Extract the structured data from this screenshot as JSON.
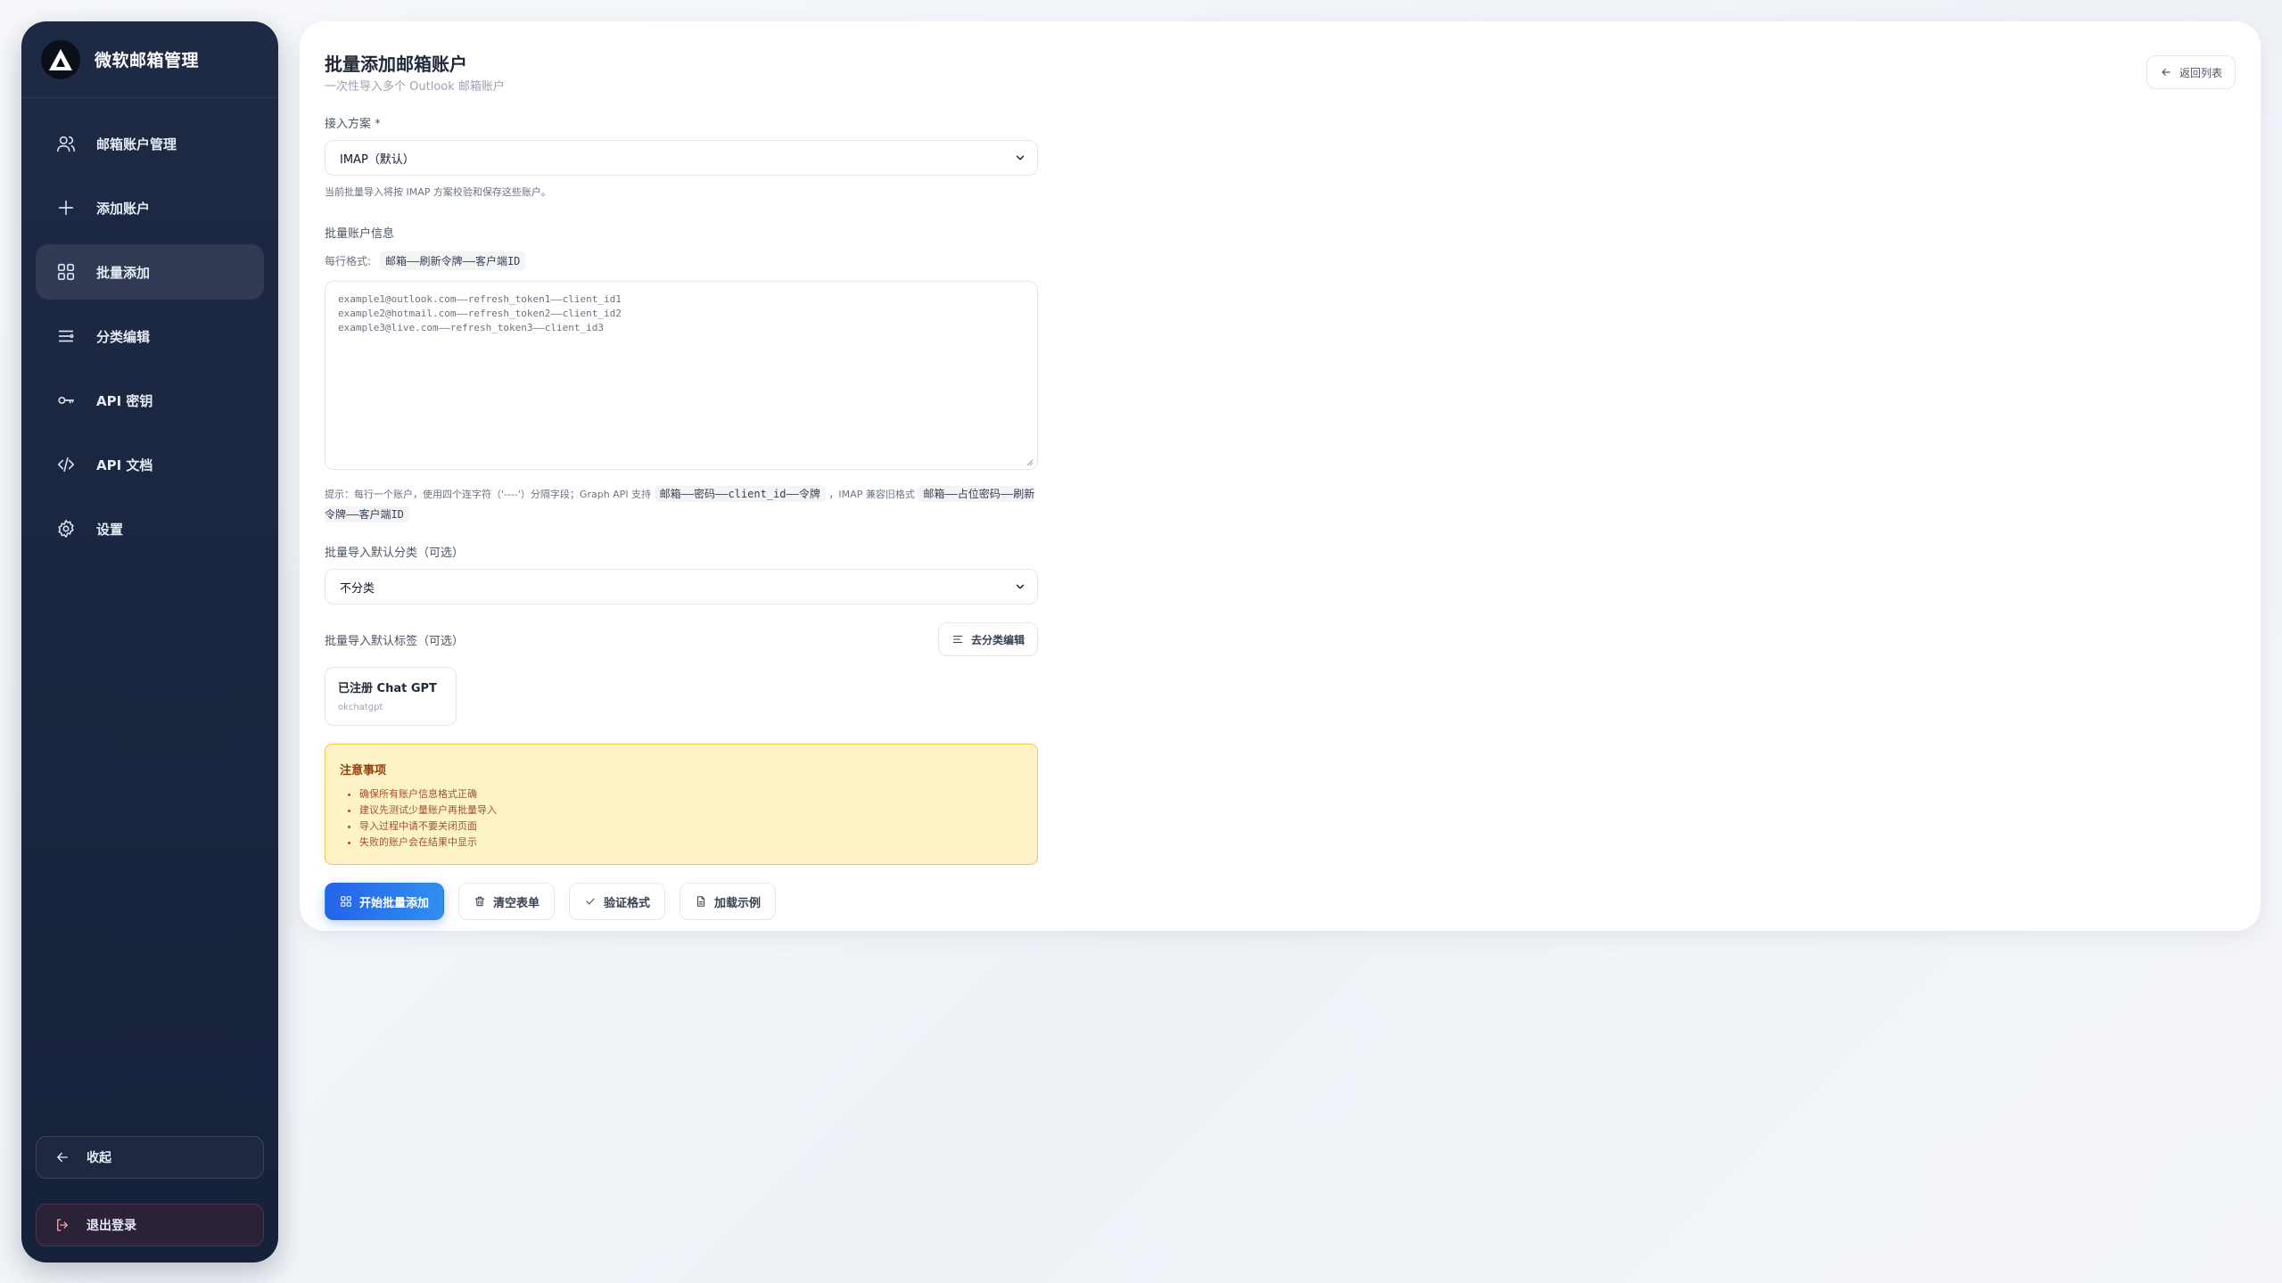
{
  "brand": {
    "title": "微软邮箱管理",
    "logo_icon": "triangle-logo-icon"
  },
  "sidebar": {
    "items": [
      {
        "label": "邮箱账户管理",
        "icon": "users-icon"
      },
      {
        "label": "添加账户",
        "icon": "plus-icon"
      },
      {
        "label": "批量添加",
        "icon": "grid-icon",
        "active": true
      },
      {
        "label": "分类编辑",
        "icon": "list-filter-icon"
      },
      {
        "label": "API 密钥",
        "icon": "key-icon"
      },
      {
        "label": "API 文档",
        "icon": "code-icon"
      },
      {
        "label": "设置",
        "icon": "gear-icon"
      }
    ],
    "collapse_label": "收起",
    "logout_label": "退出登录"
  },
  "header": {
    "title": "批量添加邮箱账户",
    "subtitle": "一次性导入多个 Outlook 邮箱账户",
    "back_label": "返回列表"
  },
  "form": {
    "scheme_label": "接入方案 *",
    "scheme_value": "IMAP（默认）",
    "scheme_help": "当前批量导入将按 IMAP 方案校验和保存这些账户。",
    "accounts_label": "批量账户信息",
    "format_prefix": "每行格式:",
    "format_code": "邮箱——刷新令牌——客户端ID",
    "textarea_lines": [
      "example1@outlook.com——refresh_token1——client_id1",
      "example2@hotmail.com——refresh_token2——client_id2",
      "example3@live.com——refresh_token3——client_id3"
    ],
    "hint_prefix": "提示：每行一个账户，使用四个连字符（'----'）分隔字段；Graph API 支持",
    "hint_code1": "邮箱——密码——client_id——令牌",
    "hint_mid": "，IMAP 兼容旧格式",
    "hint_code2": "邮箱——占位密码——刷新令牌——客户端ID",
    "category_label": "批量导入默认分类（可选）",
    "category_value": "不分类",
    "tags_label": "批量导入默认标签（可选）",
    "tags_edit_label": "去分类编辑",
    "tag": {
      "name": "已注册 Chat GPT",
      "slug": "okchatgpt"
    }
  },
  "notice": {
    "title": "注意事项",
    "items": [
      "确保所有账户信息格式正确",
      "建议先测试少量账户再批量导入",
      "导入过程中请不要关闭页面",
      "失败的账户会在结果中显示"
    ]
  },
  "actions": {
    "start": "开始批量添加",
    "clear": "清空表单",
    "validate": "验证格式",
    "load_example": "加载示例"
  },
  "colors": {
    "sidebar_bg": "#1e2a44",
    "primary": "#2563eb",
    "notice_bg": "#fef3c7",
    "notice_border": "#f6c453"
  }
}
